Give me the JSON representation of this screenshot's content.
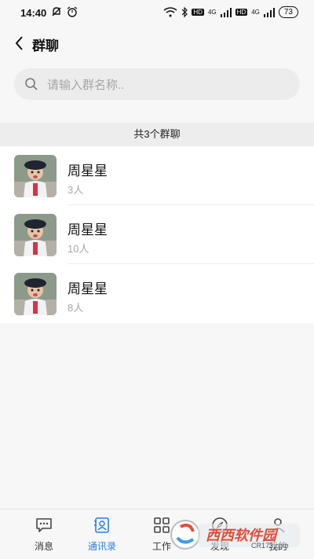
{
  "status_bar": {
    "time": "14:40",
    "hd1": "HD",
    "net1": "4G",
    "hd2": "HD",
    "net2": "4G",
    "battery": "73"
  },
  "header": {
    "title": "群聊"
  },
  "search": {
    "placeholder": "请输入群名称.."
  },
  "section": {
    "label": "共3个群聊"
  },
  "groups": [
    {
      "name": "周星星",
      "count": "3人"
    },
    {
      "name": "周星星",
      "count": "10人"
    },
    {
      "name": "周星星",
      "count": "8人"
    }
  ],
  "tabs": [
    {
      "label": "消息"
    },
    {
      "label": "通讯录"
    },
    {
      "label": "工作"
    },
    {
      "label": "发现"
    },
    {
      "label": "我的"
    }
  ],
  "watermark": {
    "text": "西西软件园",
    "sub": "CR173.com"
  },
  "colors": {
    "accent": "#2b7df1",
    "background": "#f7f7f7",
    "section": "#ededed"
  }
}
